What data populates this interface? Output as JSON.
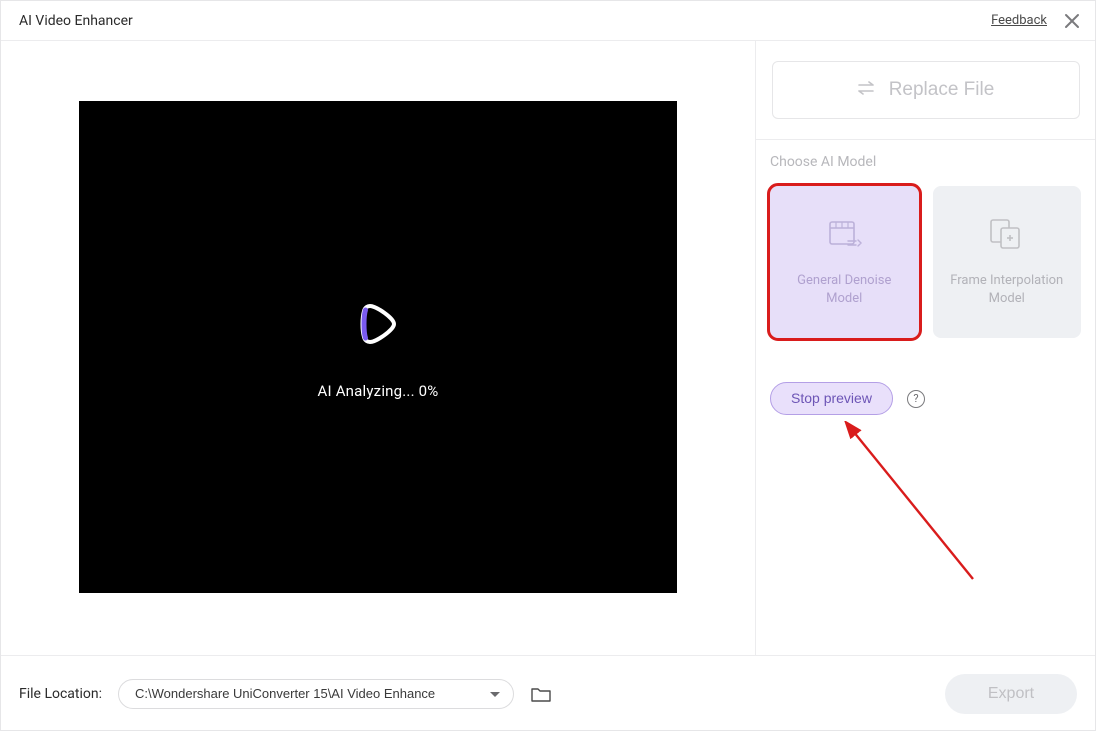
{
  "titlebar": {
    "title": "AI Video Enhancer",
    "feedback": "Feedback"
  },
  "video": {
    "status_text": "AI Analyzing...",
    "progress_pct": "0%"
  },
  "right": {
    "replace_label": "Replace File",
    "section_label": "Choose AI Model",
    "models": [
      {
        "label_line1": "General Denoise",
        "label_line2": "Model"
      },
      {
        "label_line1": "Frame Interpolation",
        "label_line2": "Model"
      }
    ],
    "stop_label": "Stop preview",
    "help_char": "?"
  },
  "footer": {
    "label": "File Location:",
    "path": "C:\\Wondershare UniConverter 15\\AI Video Enhance",
    "export_label": "Export"
  },
  "icons": {
    "close": "close-icon",
    "swap": "swap-icon",
    "denoise": "denoise-model-icon",
    "interp": "frame-interp-icon",
    "folder": "folder-icon",
    "logo": "play-logo-icon"
  }
}
